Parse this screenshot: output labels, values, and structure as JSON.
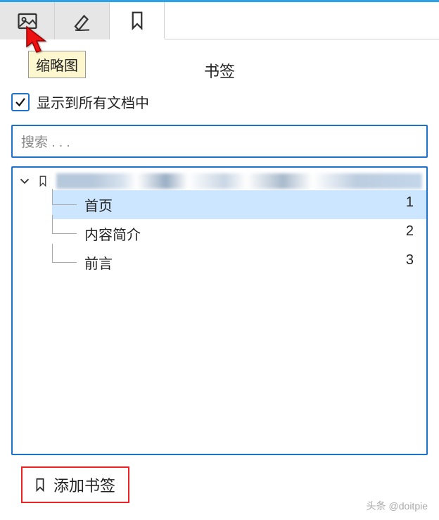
{
  "tabs": {
    "thumbnail_tooltip": "缩略图"
  },
  "panel": {
    "title": "书签",
    "show_in_all_docs": "显示到所有文档中",
    "search_placeholder": "搜索 . . ."
  },
  "tree": {
    "items": [
      {
        "label": "首页",
        "page": "1",
        "selected": true
      },
      {
        "label": "内容简介",
        "page": "2",
        "selected": false
      },
      {
        "label": "前言",
        "page": "3",
        "selected": false
      }
    ]
  },
  "actions": {
    "add_bookmark": "添加书签"
  },
  "watermark": "头条 @doitpie"
}
